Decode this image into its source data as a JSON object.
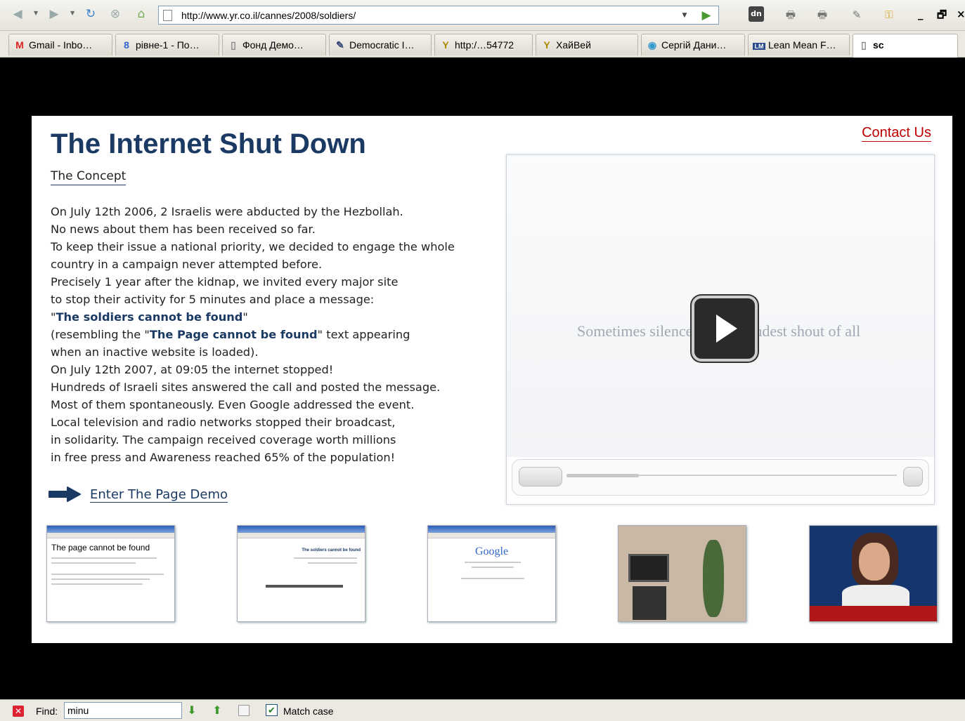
{
  "browser": {
    "url": "http://www.yr.co.il/cannes/2008/soldiers/",
    "window_controls": {
      "minimize": "_",
      "restore": "🗗",
      "close": "×"
    },
    "toolbar_icons": [
      "back-icon",
      "forward-icon",
      "refresh-icon",
      "stop-icon",
      "home-icon",
      "dn-icon",
      "print-icon",
      "print-settings-icon",
      "edit-icon",
      "key-icon"
    ],
    "dn_label": "dn",
    "tabs": [
      {
        "label": "Gmail - Inbo…",
        "icon": "gmail-icon"
      },
      {
        "label": "рівне-1 - По…",
        "icon": "google-8-icon"
      },
      {
        "label": "Фонд Демо…",
        "icon": "page-icon"
      },
      {
        "label": "Democratic I…",
        "icon": "tag-icon"
      },
      {
        "label": "http:/…54772",
        "icon": "yahoo-icon"
      },
      {
        "label": "ХайВей",
        "icon": "yahoo-icon"
      },
      {
        "label": "Сергій Дани…",
        "icon": "disc-icon"
      },
      {
        "label": "Lean Mean F…",
        "icon": "lean-mean-icon"
      },
      {
        "label": "sc",
        "icon": "page-icon",
        "active": true
      }
    ]
  },
  "page": {
    "title": "The Internet Shut Down",
    "concept_link": "The Concept",
    "contact_link": "Contact Us",
    "body_lines": [
      "On July 12th 2006, 2 Israelis were abducted by the Hezbollah.",
      "No news about them has been received so far.",
      "To keep their issue a national priority, we decided to engage the whole",
      "country in a campaign never attempted before.",
      "Precisely 1 year after the kidnap, we invited every major site",
      "to stop their activity for 5 minutes and place a message:"
    ],
    "message_bold": "The soldiers cannot be found",
    "resembling_prefix": "(resembling the \"",
    "resembling_bold": "The Page cannot be found",
    "resembling_suffix": "\" text appearing",
    "body_lines_2": [
      "when an inactive website is loaded).",
      "On July 12th 2007, at 09:05 the internet stopped!",
      "Hundreds of Israeli sites answered the call and posted the message.",
      "Most of them spontaneously. Even Google addressed the event.",
      "Local television and radio networks stopped their broadcast,",
      "in solidarity. The campaign received coverage worth millions",
      "in free press and Awareness reached 65% of the population!"
    ],
    "demo_link": "Enter The Page Demo",
    "video": {
      "caption_left": "Sometimes silence",
      "caption_right": "udest shout of all",
      "progress": 0.22
    },
    "thumbnails": [
      {
        "name": "thumb-page-cannot-be-found",
        "heading": "The page cannot be found"
      },
      {
        "name": "thumb-soldiers-msn",
        "heading": "The soldiers cannot be found"
      },
      {
        "name": "thumb-google",
        "heading": "Google"
      },
      {
        "name": "thumb-tv-room",
        "heading": ""
      },
      {
        "name": "thumb-news-anchor",
        "heading": ""
      }
    ]
  },
  "findbar": {
    "label": "Find:",
    "value": "minu",
    "match_case_label": "Match case",
    "match_case_checked": true
  },
  "colors": {
    "title": "#1b3a63",
    "contact": "#c00000",
    "background": "#000000"
  }
}
